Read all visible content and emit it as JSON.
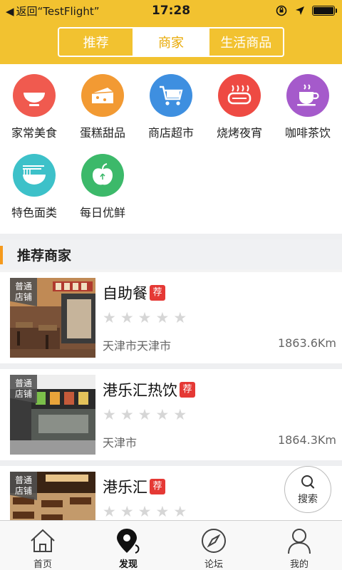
{
  "status_bar": {
    "back_label": "返回“TestFlight”",
    "time": "17:28"
  },
  "segments": [
    {
      "label": "推荐",
      "active": false
    },
    {
      "label": "商家",
      "active": true
    },
    {
      "label": "生活商品",
      "active": false
    }
  ],
  "categories": [
    {
      "label": "家常美食",
      "icon": "bowl-icon",
      "color": "#F05A4F"
    },
    {
      "label": "蛋糕甜品",
      "icon": "cake-icon",
      "color": "#F29A33"
    },
    {
      "label": "商店超市",
      "icon": "shopping-cart-icon",
      "color": "#3E8FE0"
    },
    {
      "label": "烧烤夜宵",
      "icon": "grill-icon",
      "color": "#EE4A43"
    },
    {
      "label": "咖啡茶饮",
      "icon": "coffee-cup-icon",
      "color": "#A55ACB"
    },
    {
      "label": "特色面类",
      "icon": "noodles-icon",
      "color": "#3DC1C9"
    },
    {
      "label": "每日优鲜",
      "icon": "apple-icon",
      "color": "#3CB96A"
    }
  ],
  "section": {
    "title": "推荐商家"
  },
  "badge_line1": "普通",
  "badge_line2": "店铺",
  "recommend_tag": "荐",
  "shops": [
    {
      "name": "自助餐",
      "rating": 0,
      "city": "天津市天津市",
      "distance": "1863.6Km"
    },
    {
      "name": "港乐汇热饮",
      "rating": 0,
      "city": "天津市",
      "distance": "1864.3Km"
    },
    {
      "name": "港乐汇",
      "rating": 0,
      "city": "",
      "distance": ""
    }
  ],
  "search_fab": {
    "label": "搜索"
  },
  "tabbar": [
    {
      "label": "首页",
      "icon": "home-icon",
      "active": false
    },
    {
      "label": "发现",
      "icon": "discover-pin-icon",
      "active": true
    },
    {
      "label": "论坛",
      "icon": "compass-icon",
      "active": false
    },
    {
      "label": "我的",
      "icon": "person-icon",
      "active": false
    }
  ],
  "colors": {
    "header": "#F2C230",
    "accent": "#F59A1D",
    "recommend_tag": "#E53935"
  }
}
